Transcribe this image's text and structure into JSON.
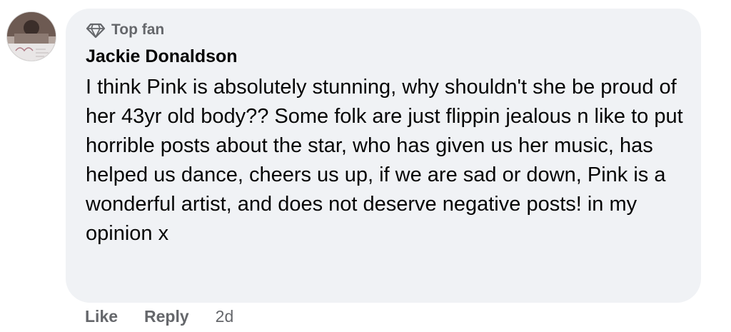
{
  "comment": {
    "badge": "Top fan",
    "badge_icon": "diamond-icon",
    "author": "Jackie Donaldson",
    "text": "I think Pink is absolutely stunning, why shouldn't she be proud of her 43yr old body?? Some folk are just flippin jealous n like to put horrible posts about the star, who has given us her music, has helped us dance, cheers us up, if we are sad or down, Pink is a wonderful artist, and does not deserve negative posts! in my opinion x",
    "bubble_color": "#f0f2f5",
    "secondary_text_color": "#65676b"
  },
  "actions": {
    "like": "Like",
    "reply": "Reply",
    "time": "2d"
  }
}
